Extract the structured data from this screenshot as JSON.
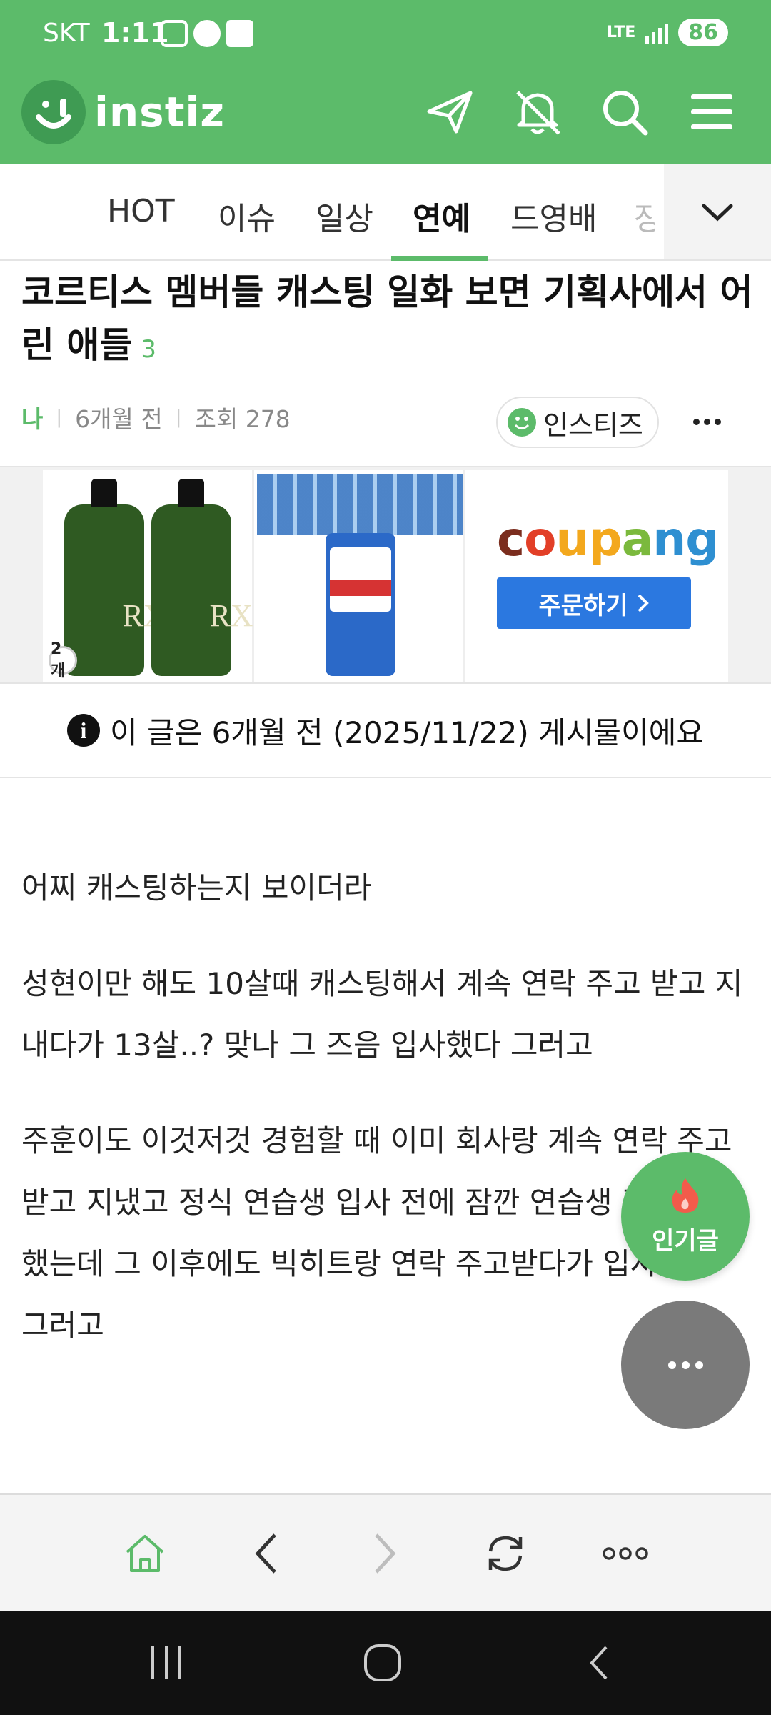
{
  "status_bar": {
    "carrier": "SKT",
    "time": "1:11",
    "network": "LTE",
    "battery": "86"
  },
  "header": {
    "logo_text": "instiz",
    "icons": [
      "send-icon",
      "notifications-off-icon",
      "search-icon",
      "menu-icon"
    ]
  },
  "tabs": {
    "items": [
      "HOT",
      "이슈",
      "일상",
      "연예",
      "드영배",
      "장"
    ],
    "active": "연예"
  },
  "article": {
    "title": "코르티스 멤버들 캐스팅 일화 보면 기획사에서 어린 애들",
    "comment_count": "3",
    "author": "나",
    "time_ago": "6개월 전",
    "views": "조회 278",
    "board": "인스티즈"
  },
  "ad": {
    "product1_label": "RX",
    "product1_qty": "2개",
    "brand_letters": [
      "c",
      "o",
      "u",
      "p",
      "a",
      "n",
      "g"
    ],
    "brand_colors": [
      "#7b2d1e",
      "#e23f27",
      "#f3a81d",
      "#f3a81d",
      "#7bb93d",
      "#2e8fd1",
      "#2e8fd1"
    ],
    "cta": "주문하기"
  },
  "notice": {
    "text": "이 글은 6개월 전 (2025/11/22) 게시물이에요"
  },
  "body": {
    "paragraphs": [
      "어찌 캐스팅하는지 보이더라",
      "성현이만 해도 10살때 캐스팅해서 계속 연락 주고 받고 지내다가 13살..? 맞나 그 즈음 입사했다 그러고",
      "주훈이도 이것저것 경험할 때 이미 회사랑 계속 연락 주고 받고 지냈고 정식 연습생 입사 전에 잠깐 연습생 같은 것도 했는데 그 이후에도 빅히트랑 연락 주고받다가 입사했다 그러고"
    ]
  },
  "fab": {
    "popular_label": "인기글"
  },
  "colors": {
    "brand_green": "#5cbb6a",
    "coupang_blue": "#2b78e0"
  }
}
